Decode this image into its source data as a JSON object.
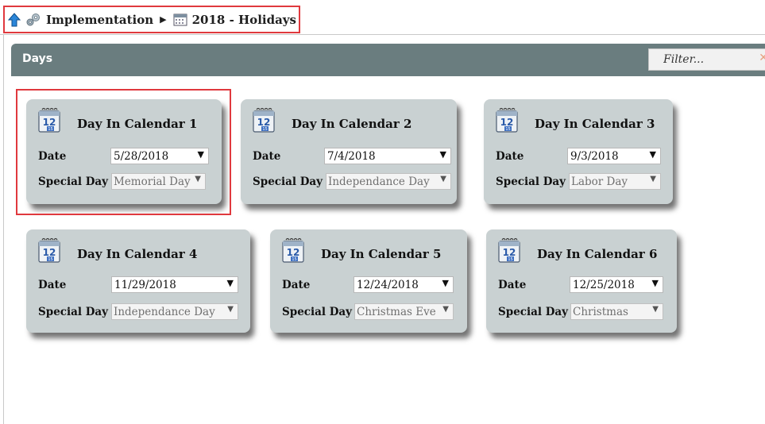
{
  "breadcrumb": {
    "items": [
      {
        "label": "Implementation"
      },
      {
        "label": "2018 - Holidays"
      }
    ]
  },
  "panel": {
    "title": "Days",
    "filter_placeholder": "Filter...",
    "clear_symbol": "✕"
  },
  "cards": [
    {
      "title": "Day In Calendar 1",
      "date_label": "Date",
      "date": "5/28/2018",
      "special_label": "Special Day",
      "special": "Memorial Day"
    },
    {
      "title": "Day In Calendar 2",
      "date_label": "Date",
      "date": "7/4/2018",
      "special_label": "Special Day",
      "special": "Independance Day"
    },
    {
      "title": "Day In Calendar 3",
      "date_label": "Date",
      "date": "9/3/2018",
      "special_label": "Special Day",
      "special": "Labor Day"
    },
    {
      "title": "Day In Calendar 4",
      "date_label": "Date",
      "date": "11/29/2018",
      "special_label": "Special Day",
      "special": "Independance Day"
    },
    {
      "title": "Day In Calendar 5",
      "date_label": "Date",
      "date": "12/24/2018",
      "special_label": "Special Day",
      "special": "Christmas Eve"
    },
    {
      "title": "Day In Calendar 6",
      "date_label": "Date",
      "date": "12/25/2018",
      "special_label": "Special Day",
      "special": "Christmas"
    }
  ],
  "icons": {
    "up": "up-arrow-icon",
    "gear": "gears-icon",
    "calendar": "calendar-icon"
  },
  "colors": {
    "header": "#6a7d7f",
    "card": "#c9d1d2",
    "highlight": "#e0393e"
  }
}
